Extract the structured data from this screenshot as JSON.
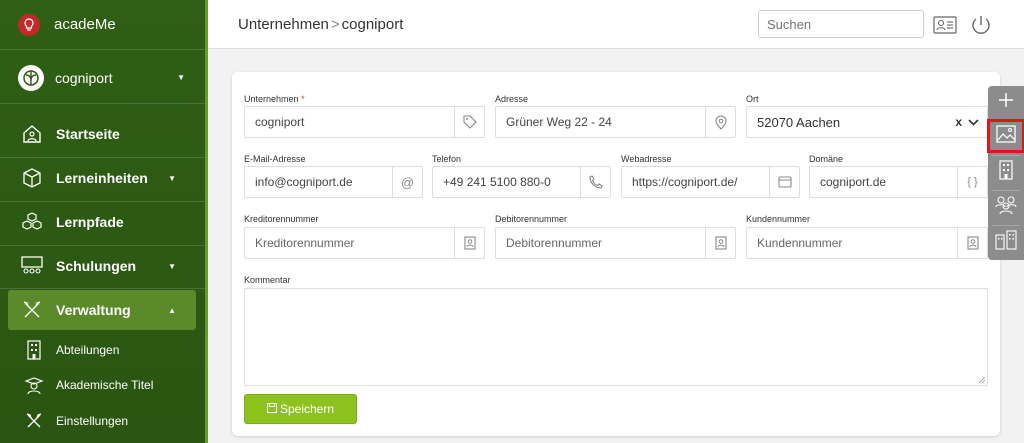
{
  "app": {
    "name": "acadeMe",
    "org": "cogniport"
  },
  "nav": [
    {
      "label": "Startseite",
      "icon": "home-icon"
    },
    {
      "label": "Lerneinheiten",
      "icon": "cube-icon"
    },
    {
      "label": "Lernpfade",
      "icon": "cubes-icon"
    },
    {
      "label": "Schulungen",
      "icon": "classroom-icon"
    },
    {
      "label": "Verwaltung",
      "icon": "tools-icon"
    }
  ],
  "subnav": [
    {
      "label": "Abteilungen",
      "icon": "building-icon"
    },
    {
      "label": "Akademische Titel",
      "icon": "graduate-icon"
    },
    {
      "label": "Einstellungen",
      "icon": "tools-icon"
    }
  ],
  "breadcrumb": {
    "parent": "Unternehmen",
    "sep": ">",
    "current": "cogniport"
  },
  "search": {
    "placeholder": "Suchen"
  },
  "form": {
    "company": {
      "label": "Unternehmen",
      "required": "*",
      "value": "cogniport"
    },
    "address": {
      "label": "Adresse",
      "value": "Grüner Weg 22 - 24"
    },
    "city": {
      "label": "Ort",
      "value": "52070 Aachen",
      "clear": "x"
    },
    "email": {
      "label": "E-Mail-Adresse",
      "value": "info@cogniport.de"
    },
    "phone": {
      "label": "Telefon",
      "value": "+49 241 5100 880-0"
    },
    "web": {
      "label": "Webadresse",
      "value": "https://cogniport.de/"
    },
    "domain": {
      "label": "Domäne",
      "value": "cogniport.de"
    },
    "creditor": {
      "label": "Kreditorennummer",
      "placeholder": "Kreditorennummer"
    },
    "debtor": {
      "label": "Debitorennummer",
      "placeholder": "Debitorennummer"
    },
    "customer": {
      "label": "Kundennummer",
      "placeholder": "Kundennummer"
    },
    "comment": {
      "label": "Kommentar",
      "value": ""
    },
    "save_label": "Speichern"
  },
  "colors": {
    "sidebar": "#2f5a14",
    "active": "#5b8a2b",
    "save": "#8dc21f",
    "highlight": "#e0151b"
  }
}
